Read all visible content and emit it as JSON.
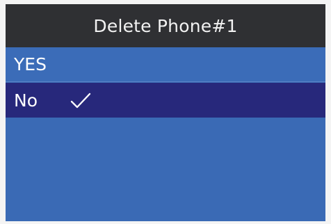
{
  "dialog": {
    "title": "Delete Phone#1"
  },
  "options": [
    {
      "label": "YES",
      "selected": false
    },
    {
      "label": "No",
      "selected": true,
      "check_icon": "checkmark-icon"
    }
  ],
  "colors": {
    "title_background": "#2f3033",
    "list_background": "#3a6ab5",
    "selected_background": "#27287b",
    "text": "#ffffff"
  }
}
